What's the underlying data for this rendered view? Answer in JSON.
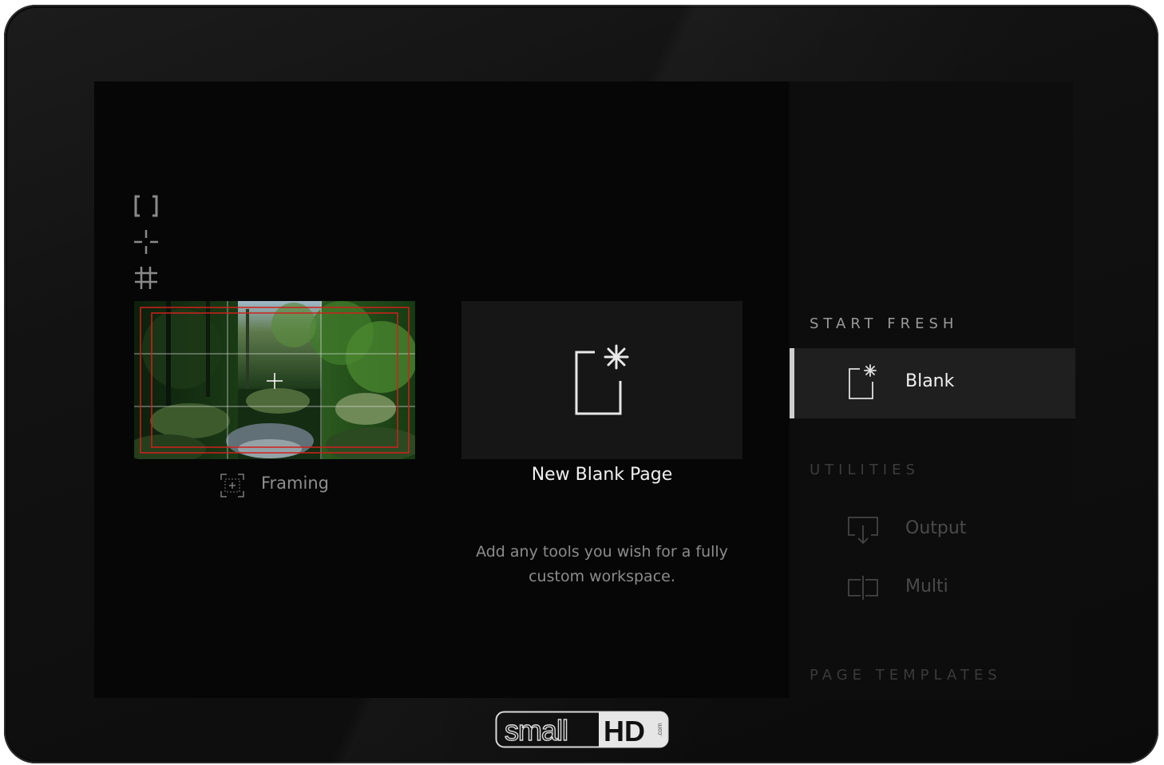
{
  "toolbar": {
    "icons": [
      "brackets-icon",
      "crosshair-icon",
      "grid-icon"
    ]
  },
  "framing": {
    "label": "Framing",
    "icon": "framing-icon"
  },
  "blank_page": {
    "title": "New Blank Page",
    "description_line1": "Add any tools you wish for a fully",
    "description_line2": "custom workspace."
  },
  "sidebar": {
    "start_fresh": "START FRESH",
    "blank_label": "Blank",
    "utilities": "UTILITIES",
    "output_label": "Output",
    "multi_label": "Multi",
    "page_templates": "PAGE TEMPLATES"
  },
  "brand": {
    "logo_text": "smallHD",
    "logo_suffix": ".com"
  },
  "colors": {
    "accent_active": "#cfcfcf",
    "guide_red": "#d0201c"
  }
}
